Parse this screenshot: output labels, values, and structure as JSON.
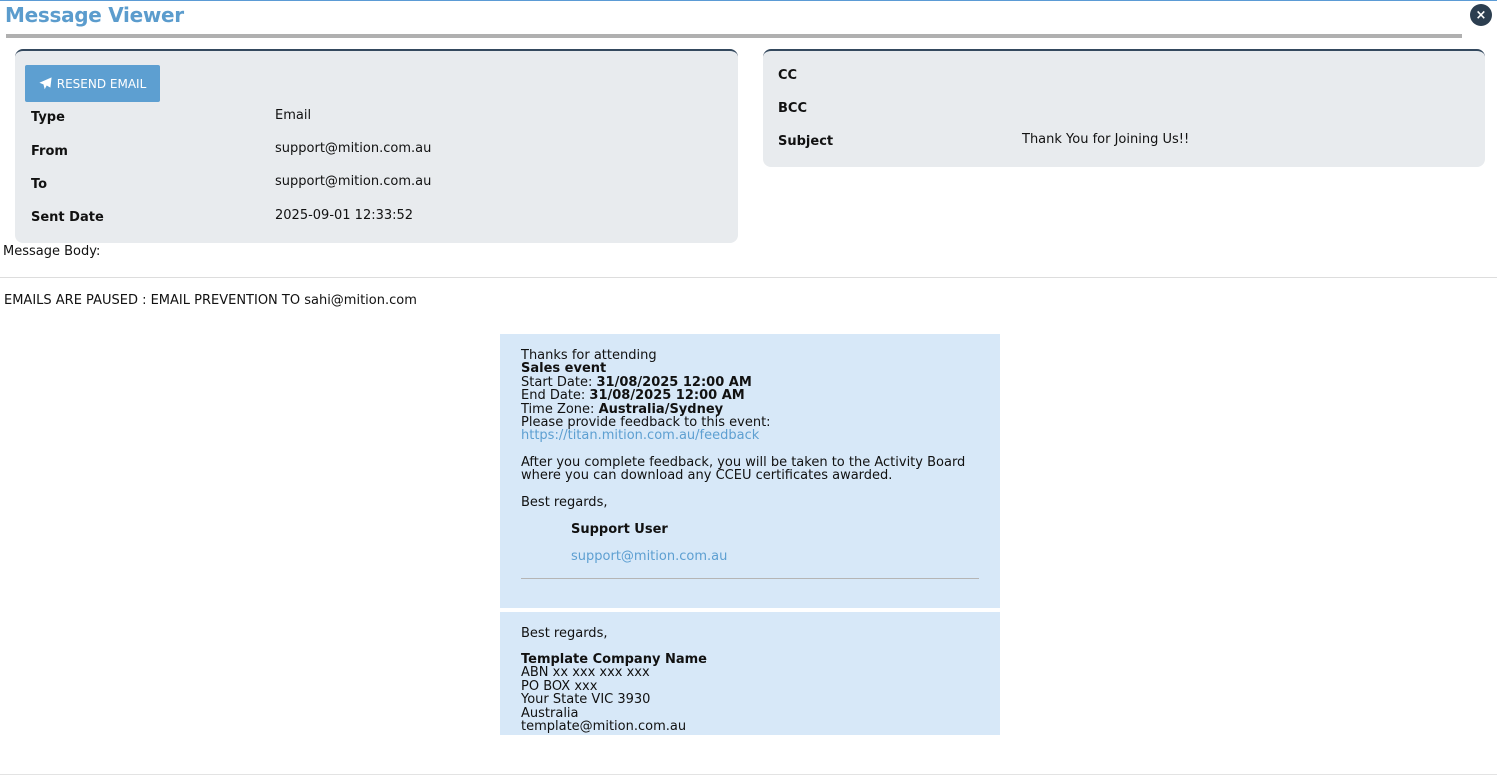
{
  "window": {
    "title": "Message Viewer",
    "close_label": "×"
  },
  "actions": {
    "resend_label": "RESEND EMAIL"
  },
  "details_left": {
    "type_label": "Type",
    "type_value": "Email",
    "from_label": "From",
    "from_value": "support@mition.com.au",
    "to_label": "To",
    "to_value": "support@mition.com.au",
    "sent_label": "Sent Date",
    "sent_value": "2025-09-01 12:33:52"
  },
  "details_right": {
    "cc_label": "CC",
    "cc_value": "",
    "bcc_label": "BCC",
    "bcc_value": "",
    "subject_label": "Subject",
    "subject_value": "Thank You for Joining Us!!"
  },
  "message": {
    "body_label": "Message Body:",
    "paused_notice": "EMAILS ARE PAUSED : EMAIL PREVENTION TO sahi@mition.com",
    "thanks": "Thanks for attending",
    "event_name": "Sales event",
    "start_label": "Start Date: ",
    "start_value": "31/08/2025 12:00 AM",
    "end_label": "End Date: ",
    "end_value": "31/08/2025 12:00 AM",
    "tz_label": "Time Zone: ",
    "tz_value": "Australia/Sydney",
    "feedback_prompt": "Please provide feedback to this event:",
    "feedback_link": "https://titan.mition.com.au/feedback",
    "after_line1": "After you complete feedback, you will be taken to the Activity Board",
    "after_line2": "where you can download any CCEU certificates awarded.",
    "regards": "Best regards,",
    "sender_name": "Support User",
    "sender_email": "support@mition.com.au"
  },
  "footer": {
    "regards": "Best regards,",
    "company": "Template Company Name",
    "abn": "ABN xx xxx xxx xxx",
    "po": "PO BOX xxx",
    "state": "Your State VIC 3930",
    "country": "Australia",
    "email": "template@mition.com.au"
  }
}
